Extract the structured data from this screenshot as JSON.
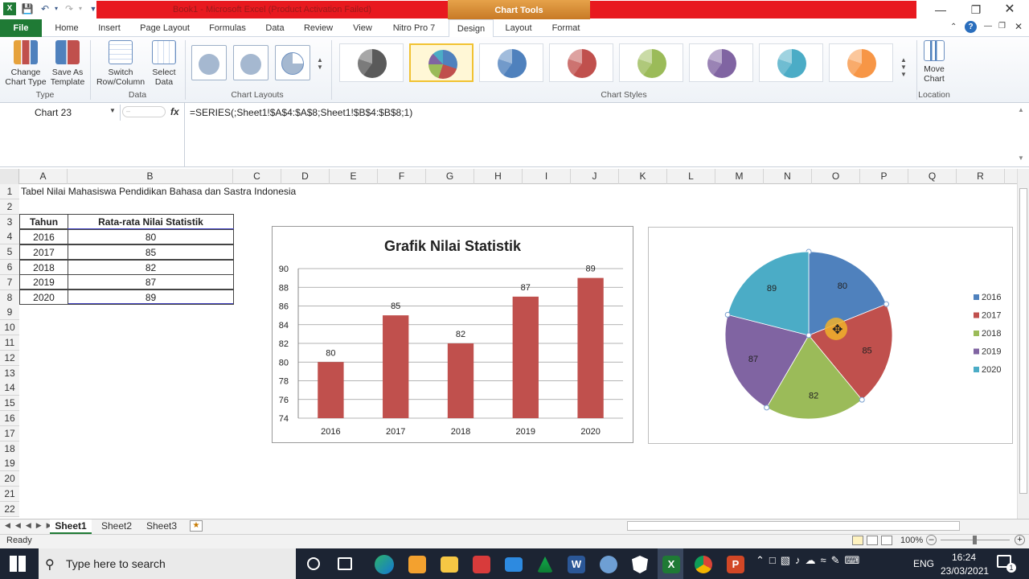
{
  "window": {
    "title": "Book1 - Microsoft Excel (Product Activation Failed)",
    "chart_tools": "Chart Tools"
  },
  "tabs": [
    "File",
    "Home",
    "Insert",
    "Page Layout",
    "Formulas",
    "Data",
    "Review",
    "View",
    "Nitro Pro 7",
    "Design",
    "Layout",
    "Format"
  ],
  "ribbon": {
    "type_group": {
      "label": "Type",
      "btn1": "Change\nChart Type",
      "btn2": "Save As\nTemplate"
    },
    "data_group": {
      "label": "Data",
      "btn1": "Switch\nRow/Column",
      "btn2": "Select\nData"
    },
    "layouts_label": "Chart Layouts",
    "styles_label": "Chart Styles",
    "location_group": {
      "label": "Location",
      "btn": "Move\nChart"
    },
    "style_colors": [
      "#5a5a5a",
      "#4f81bd",
      "#4f81bd",
      "#c0504d",
      "#9bbb59",
      "#8064a2",
      "#4bacc6",
      "#f79646"
    ]
  },
  "formula_bar": {
    "name_box": "Chart 23",
    "fx": "fx",
    "formula": "=SERIES(;Sheet1!$A$4:$A$8;Sheet1!$B$4:$B$8;1)"
  },
  "columns": [
    "A",
    "B",
    "C",
    "D",
    "E",
    "F",
    "G",
    "H",
    "I",
    "J",
    "K",
    "L",
    "M",
    "N",
    "O",
    "P",
    "Q",
    "R"
  ],
  "rows": [
    "1",
    "2",
    "3",
    "4",
    "5",
    "6",
    "7",
    "8",
    "9",
    "10",
    "11",
    "12",
    "13",
    "14",
    "15",
    "16",
    "17",
    "18",
    "19",
    "20",
    "21",
    "22"
  ],
  "sheet": {
    "a1": "Tabel Nilai Mahasiswa Pendidikan Bahasa dan Sastra Indonesia",
    "headers": [
      "Tahun",
      "Rata-rata Nilai Statistik"
    ],
    "table": [
      [
        "2016",
        "80"
      ],
      [
        "2017",
        "85"
      ],
      [
        "2018",
        "82"
      ],
      [
        "2019",
        "87"
      ],
      [
        "2020",
        "89"
      ]
    ]
  },
  "chart_data": [
    {
      "type": "bar",
      "title": "Grafik Nilai Statistik",
      "categories": [
        "2016",
        "2017",
        "2018",
        "2019",
        "2020"
      ],
      "values": [
        80,
        85,
        82,
        87,
        89
      ],
      "ylim": [
        74,
        90
      ],
      "yticks": [
        "74",
        "76",
        "78",
        "80",
        "82",
        "84",
        "86",
        "88",
        "90"
      ],
      "color": "#c0504d",
      "grid": true
    },
    {
      "type": "pie",
      "categories": [
        "2016",
        "2017",
        "2018",
        "2019",
        "2020"
      ],
      "values": [
        80,
        85,
        82,
        87,
        89
      ],
      "colors": [
        "#4f81bd",
        "#c0504d",
        "#9bbb59",
        "#8064a2",
        "#4bacc6"
      ],
      "legend": "right"
    }
  ],
  "sheet_tabs": [
    "Sheet1",
    "Sheet2",
    "Sheet3"
  ],
  "status": {
    "ready": "Ready",
    "zoom": "100%"
  },
  "taskbar": {
    "search_placeholder": "Type here to search",
    "lang": "ENG",
    "time": "16:24",
    "date": "23/03/2021",
    "notif": "1"
  }
}
